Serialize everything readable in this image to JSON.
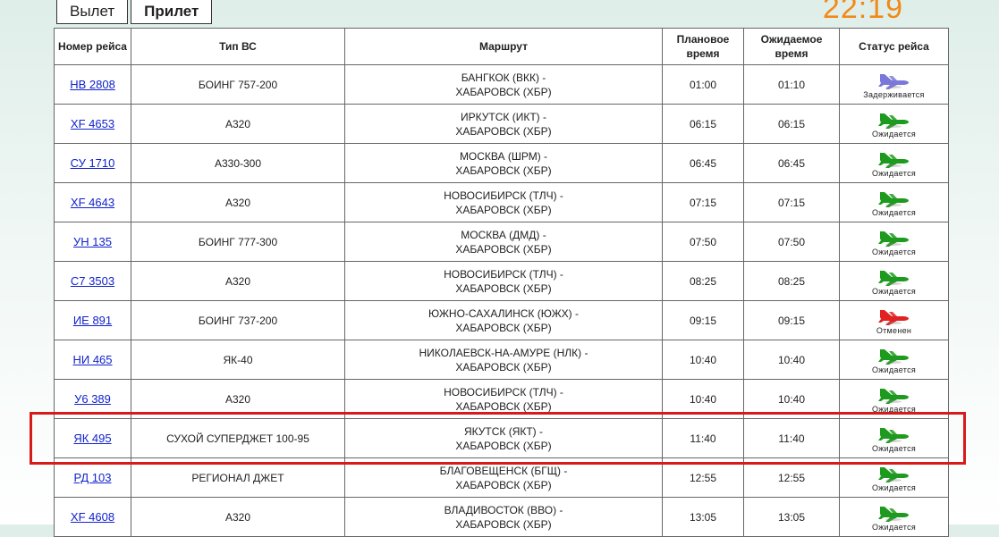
{
  "tabs": {
    "departure": "Вылет",
    "arrival": "Прилет"
  },
  "clock": "22:19",
  "columns": [
    "Номер рейса",
    "Тип ВС",
    "Маршрут",
    "Плановое время",
    "Ожидаемое время",
    "Статус рейса"
  ],
  "colors": {
    "ontime": "#1e9b1e",
    "delayed": "#7a78d8",
    "cancelled": "#e02222",
    "clock": "#f08a18",
    "link": "#1122cc"
  },
  "flights": [
    {
      "num": "НВ 2808",
      "type": "БОИНГ 757-200",
      "route1": "БАНГКОК (ВКК) -",
      "route2": "ХАБАРОВСК (ХБР)",
      "planned": "01:00",
      "expected": "01:10",
      "status": "Задерживается",
      "status_kind": "delayed"
    },
    {
      "num": "XF 4653",
      "type": "A320",
      "route1": "ИРКУТСК (ИКТ) -",
      "route2": "ХАБАРОВСК (ХБР)",
      "planned": "06:15",
      "expected": "06:15",
      "status": "Ожидается",
      "status_kind": "ontime"
    },
    {
      "num": "СУ 1710",
      "type": "A330-300",
      "route1": "МОСКВА (ШРМ) -",
      "route2": "ХАБАРОВСК (ХБР)",
      "planned": "06:45",
      "expected": "06:45",
      "status": "Ожидается",
      "status_kind": "ontime"
    },
    {
      "num": "XF 4643",
      "type": "A320",
      "route1": "НОВОСИБИРСК (ТЛЧ) -",
      "route2": "ХАБАРОВСК (ХБР)",
      "planned": "07:15",
      "expected": "07:15",
      "status": "Ожидается",
      "status_kind": "ontime"
    },
    {
      "num": "УН 135",
      "type": "БОИНГ 777-300",
      "route1": "МОСКВА (ДМД) -",
      "route2": "ХАБАРОВСК (ХБР)",
      "planned": "07:50",
      "expected": "07:50",
      "status": "Ожидается",
      "status_kind": "ontime"
    },
    {
      "num": "С7 3503",
      "type": "A320",
      "route1": "НОВОСИБИРСК (ТЛЧ) -",
      "route2": "ХАБАРОВСК (ХБР)",
      "planned": "08:25",
      "expected": "08:25",
      "status": "Ожидается",
      "status_kind": "ontime"
    },
    {
      "num": "ИЕ 891",
      "type": "БОИНГ 737-200",
      "route1": "ЮЖНО-САХАЛИНСК (ЮЖХ) -",
      "route2": "ХАБАРОВСК (ХБР)",
      "planned": "09:15",
      "expected": "09:15",
      "status": "Отменен",
      "status_kind": "cancelled"
    },
    {
      "num": "НИ 465",
      "type": "ЯК-40",
      "route1": "НИКОЛАЕВСК-НА-АМУРЕ (НЛК) -",
      "route2": "ХАБАРОВСК (ХБР)",
      "planned": "10:40",
      "expected": "10:40",
      "status": "Ожидается",
      "status_kind": "ontime"
    },
    {
      "num": "У6 389",
      "type": "A320",
      "route1": "НОВОСИБИРСК (ТЛЧ) -",
      "route2": "ХАБАРОВСК (ХБР)",
      "planned": "10:40",
      "expected": "10:40",
      "status": "Ожидается",
      "status_kind": "ontime"
    },
    {
      "num": "ЯК 495",
      "type": "СУХОЙ СУПЕРДЖЕТ 100-95",
      "route1": "ЯКУТСК (ЯКТ) -",
      "route2": "ХАБАРОВСК (ХБР)",
      "planned": "11:40",
      "expected": "11:40",
      "status": "Ожидается",
      "status_kind": "ontime"
    },
    {
      "num": "РД 103",
      "type": "РЕГИОНАЛ ДЖЕТ",
      "route1": "БЛАГОВЕЩЕНСК (БГЩ) -",
      "route2": "ХАБАРОВСК (ХБР)",
      "planned": "12:55",
      "expected": "12:55",
      "status": "Ожидается",
      "status_kind": "ontime"
    },
    {
      "num": "XF 4608",
      "type": "A320",
      "route1": "ВЛАДИВОСТОК (ВВО) -",
      "route2": "ХАБАРОВСК (ХБР)",
      "planned": "13:05",
      "expected": "13:05",
      "status": "Ожидается",
      "status_kind": "ontime"
    }
  ]
}
